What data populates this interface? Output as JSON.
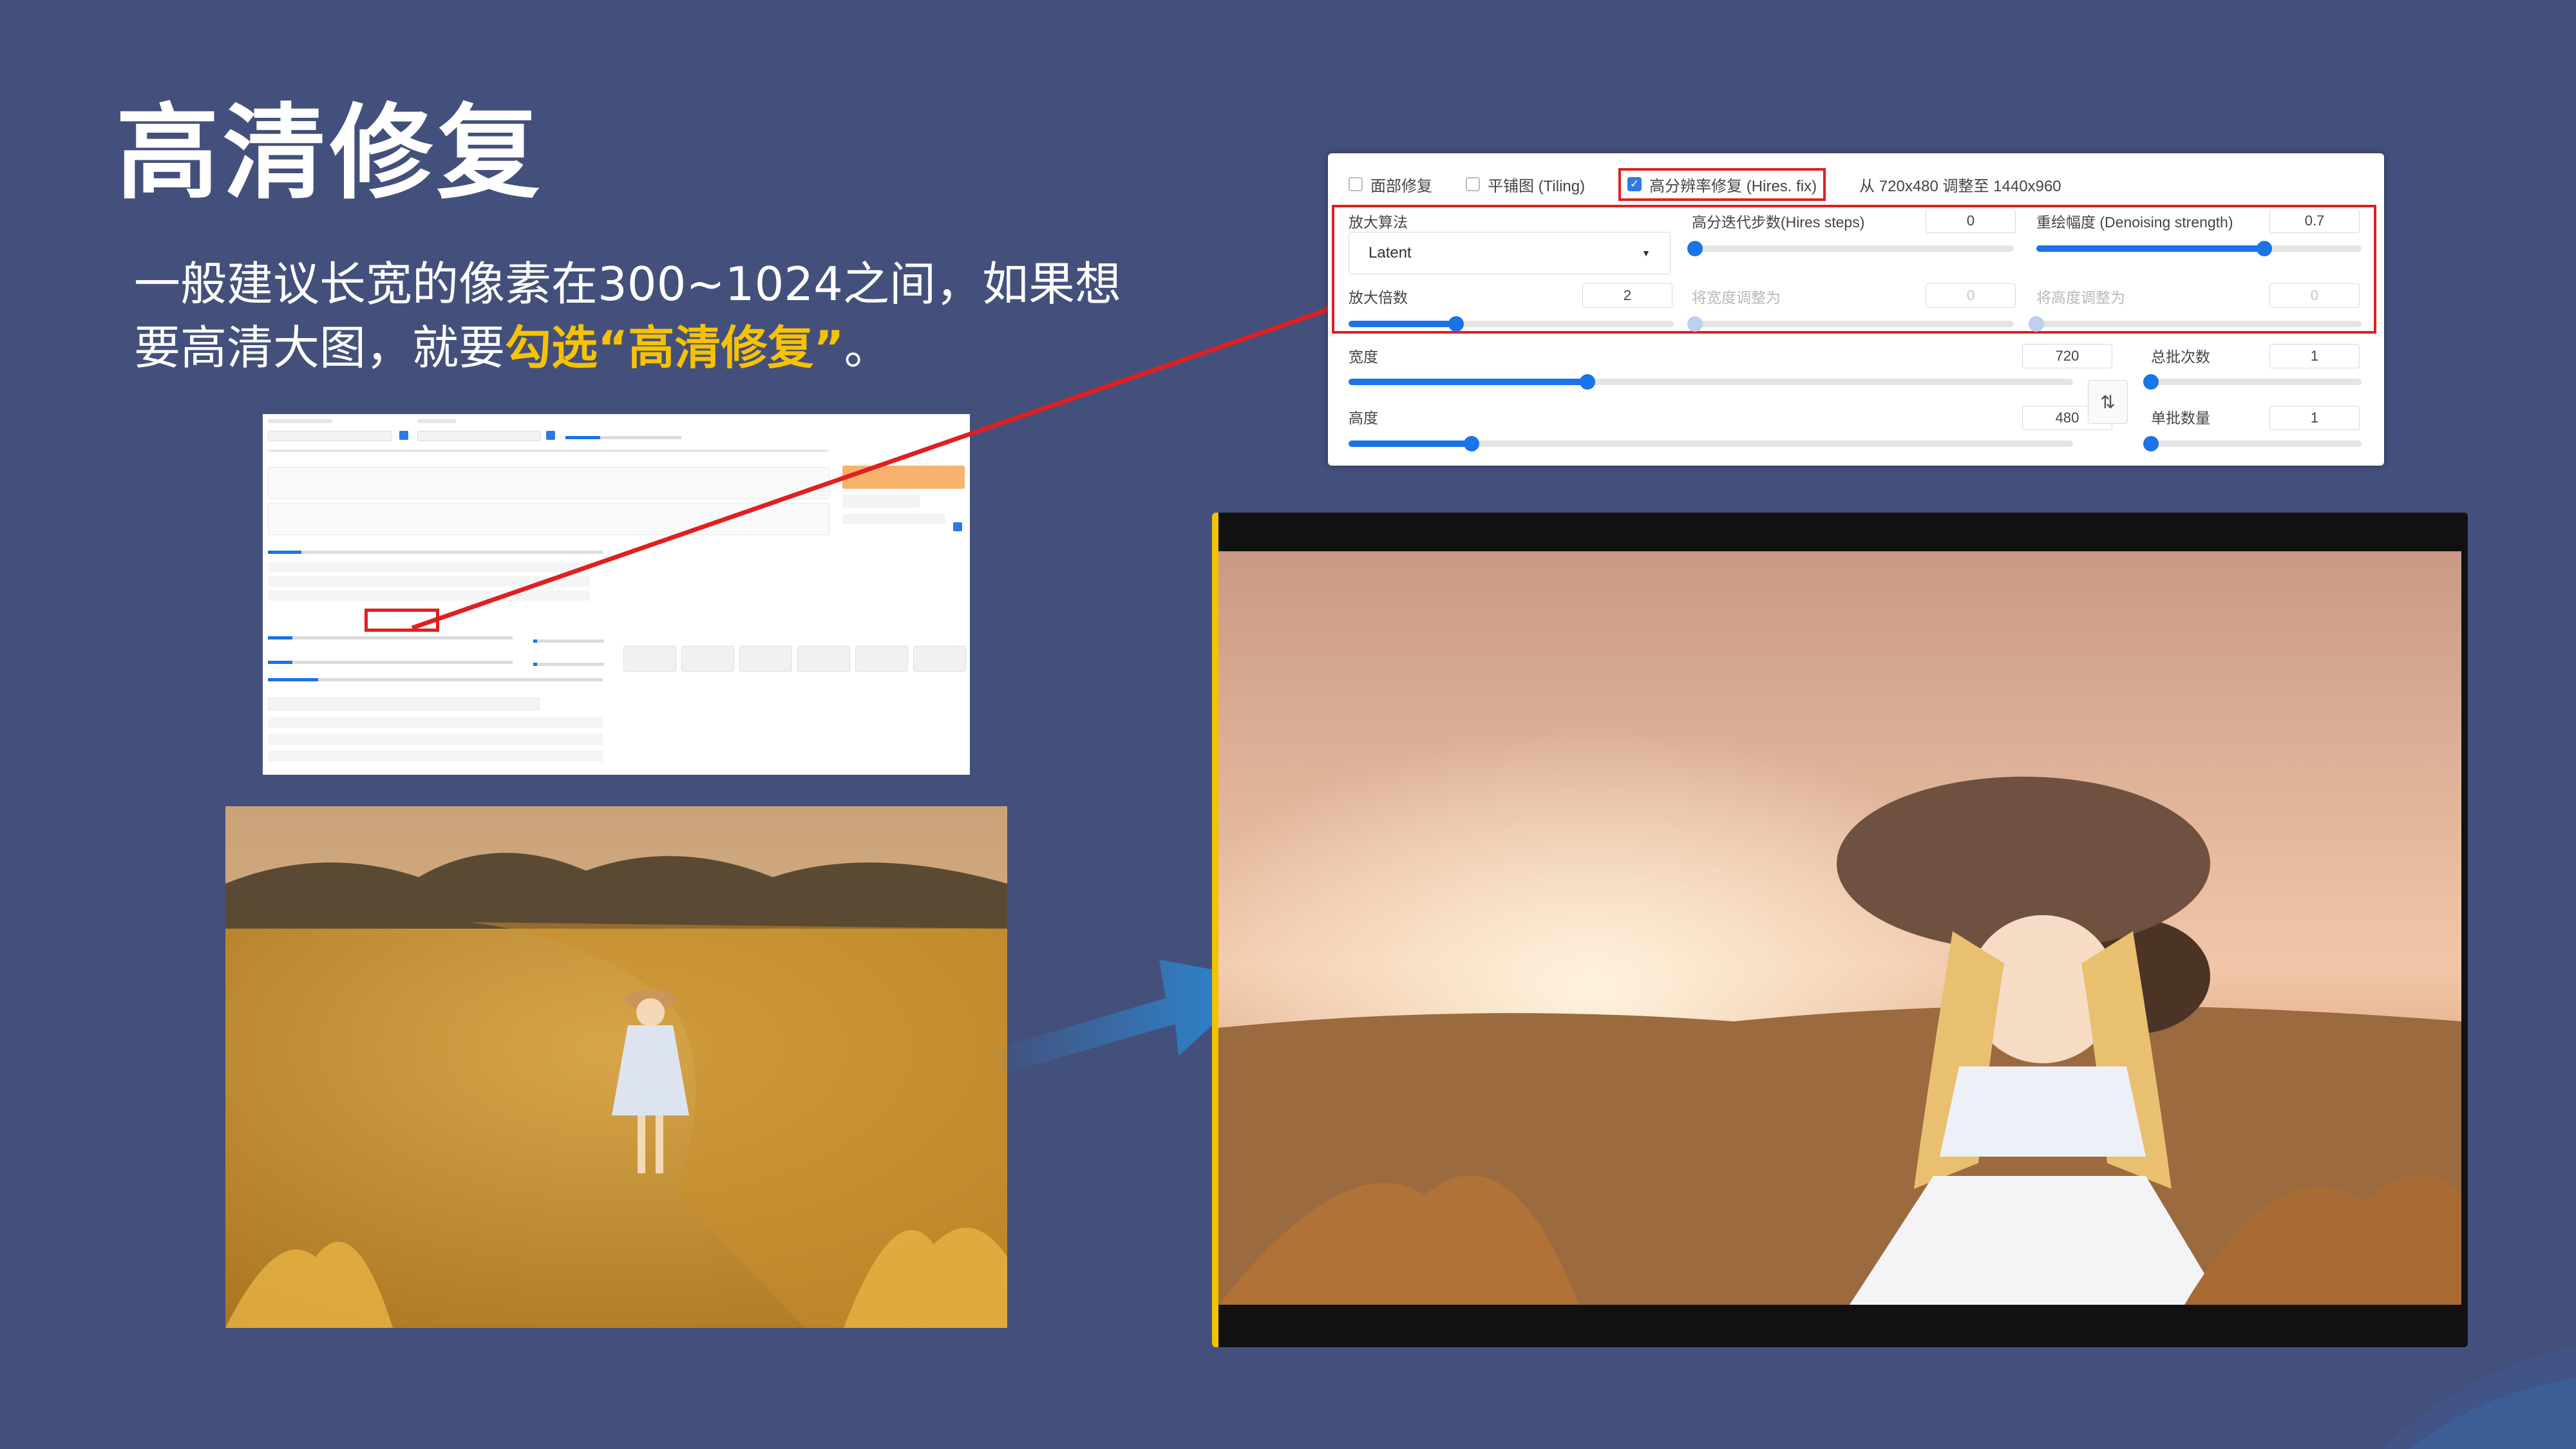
{
  "slide": {
    "title": "高清修复",
    "line1": "一般建议长宽的像素在300~1024之间，如果想",
    "line2_prefix": "要高清大图，就要",
    "line2_highlight": "勾选“高清修复”",
    "line2_suffix": "。"
  },
  "panel": {
    "face_restore_label": "面部修复",
    "tiling_label": "平铺图 (Tiling)",
    "hires_label": "高分辨率修复 (Hires. fix)",
    "hires_checked": true,
    "scale_info": "从 720x480 调整至 1440x960",
    "upscaler_label": "放大算法",
    "upscaler_value": "Latent",
    "hires_steps_label": "高分迭代步数(Hires steps)",
    "hires_steps_value": "0",
    "denoising_label": "重绘幅度 (Denoising strength)",
    "denoising_value": "0.7",
    "upscale_by_label": "放大倍数",
    "upscale_by_value": "2",
    "resize_width_label": "将宽度调整为",
    "resize_width_value": "0",
    "resize_height_label": "将高度调整为",
    "resize_height_value": "0",
    "width_label": "宽度",
    "width_value": "720",
    "height_label": "高度",
    "height_value": "480",
    "batch_count_label": "总批次数",
    "batch_count_value": "1",
    "batch_size_label": "单批数量",
    "batch_size_value": "1",
    "swap_icon": "swap-vertical-icon"
  },
  "colors": {
    "background": "#44507c",
    "highlight": "#f7c300",
    "accent_red": "#e02020",
    "slider_blue": "#1a73e8",
    "arrow_blue": "#2a8ad6"
  }
}
